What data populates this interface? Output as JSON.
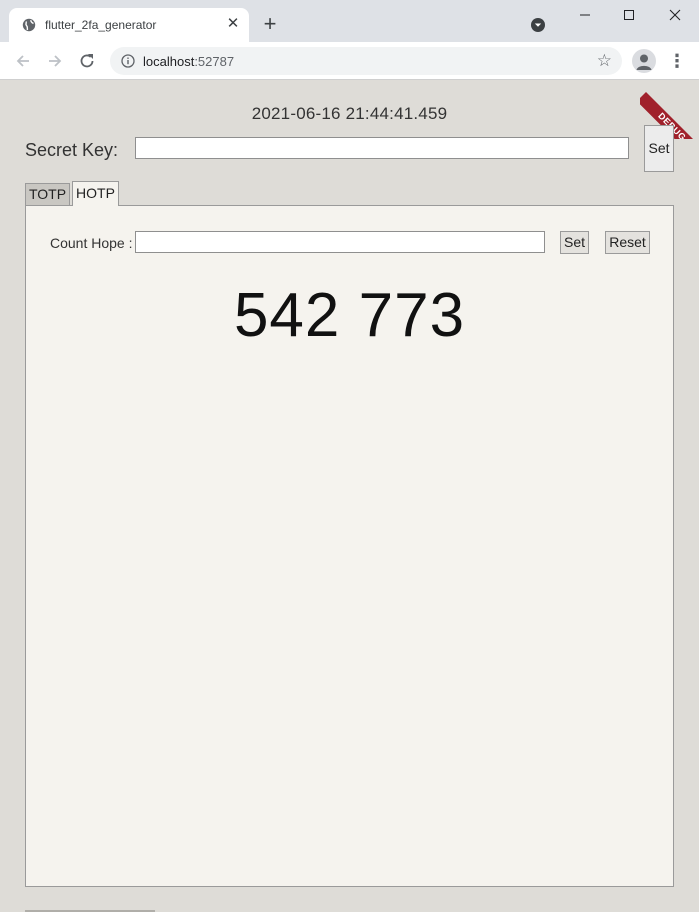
{
  "browser": {
    "tab_title": "flutter_2fa_generator",
    "close_symbol": "✕",
    "new_tab_symbol": "+",
    "url_host": "localhost",
    "url_port": ":52787",
    "icons": [
      "globe-icon",
      "close-icon",
      "plus-icon",
      "tab-search-icon",
      "minimize-icon",
      "maximize-icon",
      "window-close-icon",
      "back-icon",
      "forward-icon",
      "reload-icon",
      "info-icon",
      "star-icon",
      "profile-icon",
      "kebab-menu-icon"
    ]
  },
  "app": {
    "debug_label": "DEBUG",
    "datetime": "2021-06-16 21:44:41.459",
    "secret_key_label": "Secret Key:",
    "secret_key_value": "",
    "secret_set_label": "Set",
    "tabs": [
      {
        "label": "TOTP",
        "selected": false
      },
      {
        "label": "HOTP",
        "selected": true
      }
    ],
    "hotp": {
      "count_label": "Count Hope :",
      "count_value": "",
      "set_label": "Set",
      "reset_label": "Reset",
      "code": "542 773"
    }
  },
  "colors": {
    "background": "#dedcd7",
    "panel": "#f5f3ee",
    "debug_ribbon": "#a0212b"
  }
}
